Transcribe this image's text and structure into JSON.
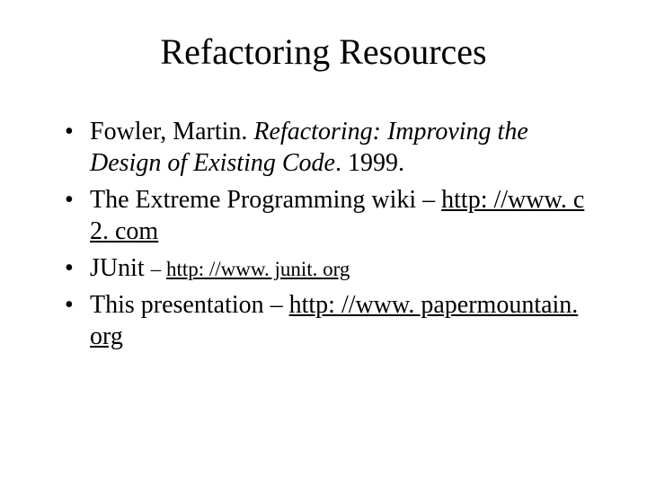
{
  "title": "Refactoring Resources",
  "items": {
    "i0": {
      "author": "Fowler, Martin.  ",
      "book_title": "Refactoring: Improving the Design of Existing Code",
      "after": ".  1999."
    },
    "i1": {
      "text": "The Extreme Programming wiki – ",
      "link": "http: //www. c 2. com"
    },
    "i2": {
      "text": "JUnit ",
      "dash_small": "– ",
      "link": "http: //www. junit. org"
    },
    "i3": {
      "text": "This presentation – ",
      "link": "http: //www. papermountain. org"
    }
  }
}
